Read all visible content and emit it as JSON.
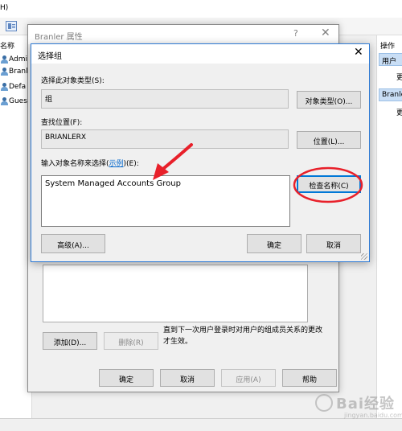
{
  "bg_window": {
    "menu_fragment": "H)",
    "list_header": "名称",
    "users": [
      "Admi",
      "Branl",
      "Defa",
      "Gues"
    ],
    "actions_header": "操作",
    "actions": [
      "用户",
      "Branle"
    ],
    "action_more": "更"
  },
  "props_dialog": {
    "title": "Branler 属性",
    "help_glyph": "?",
    "close_glyph": "✕",
    "add_button": "添加(D)...",
    "remove_button": "删除(R)",
    "note": "直到下一次用户登录时对用户的组成员关系的更改才生效。",
    "ok_button": "确定",
    "cancel_button": "取消",
    "apply_button": "应用(A)",
    "help_button": "帮助"
  },
  "select_dialog": {
    "title": "选择组",
    "close_glyph": "✕",
    "object_type_label": "选择此对象类型(S):",
    "object_type_value": "组",
    "object_type_button": "对象类型(O)...",
    "location_label": "查找位置(F):",
    "location_value": "BRIANLERX",
    "location_button": "位置(L)...",
    "names_label_prefix": "输入对象名称来选择(",
    "names_label_link": "示例",
    "names_label_suffix": ")(E):",
    "names_value": "System Managed Accounts Group",
    "check_names_button": "检查名称(C)",
    "advanced_button": "高级(A)...",
    "ok_button": "确定",
    "cancel_button": "取消"
  },
  "annotation_colors": {
    "arrow": "#e8202a",
    "circle": "#e8202a",
    "accent": "#0078d7"
  },
  "watermark": {
    "text": "Bai经验",
    "sub": "jingyan.baidu.com"
  }
}
